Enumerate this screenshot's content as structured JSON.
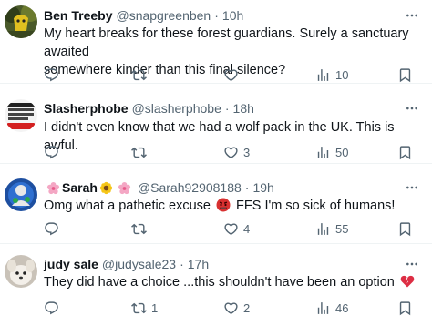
{
  "replies": [
    {
      "name": "Ben Treeby",
      "handle": "@snapgreenben",
      "dot": "·",
      "time": "10h",
      "text_line1": "My heart breaks for these forest guardians. Surely a sanctuary awaited",
      "text_line2": "somewhere kinder than this final silence?",
      "replies_count": "",
      "retweets_count": "",
      "likes_count": "",
      "views_count": "10"
    },
    {
      "name": "Slasherphobe",
      "handle": "@slasherphobe",
      "dot": "·",
      "time": "18h",
      "text_line1": "I didn't even know that we had a wolf pack in the UK. This is awful.",
      "replies_count": "",
      "retweets_count": "",
      "likes_count": "3",
      "views_count": "50"
    },
    {
      "name": "Sarah",
      "handle": "@Sarah92908188",
      "dot": "·",
      "time": "19h",
      "text_before": "Omg what a pathetic excuse",
      "text_after": "FFS I'm so sick of humans!",
      "replies_count": "",
      "retweets_count": "",
      "likes_count": "4",
      "views_count": "55"
    },
    {
      "name": "judy sale",
      "handle": "@judysale23",
      "dot": "·",
      "time": "17h",
      "text_line1": "They did have a choice ...this shouldn't have been an option",
      "replies_count": "",
      "retweets_count": "1",
      "likes_count": "2",
      "views_count": "46"
    }
  ],
  "icons": {
    "reply": "reply-icon",
    "retweet": "retweet-icon",
    "like": "heart-icon",
    "views": "views-icon",
    "bookmark": "bookmark-icon",
    "more": "more-icon"
  },
  "colors": {
    "text": "#0f1419",
    "secondary": "#536471",
    "divider": "#eff3f4"
  }
}
